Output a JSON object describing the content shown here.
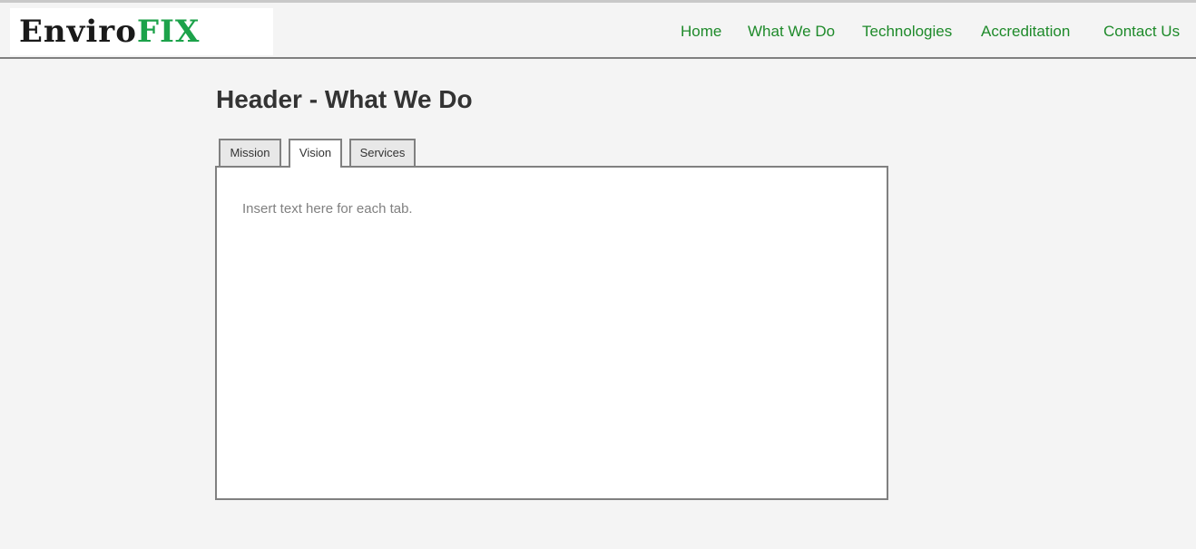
{
  "header": {
    "logo": {
      "part1": "Enviro",
      "part2": "FIX"
    },
    "nav": [
      {
        "label": "Home"
      },
      {
        "label": "What We Do"
      },
      {
        "label": "Technologies"
      },
      {
        "label": "Accreditation"
      },
      {
        "label": "Contact Us"
      }
    ]
  },
  "main": {
    "title": "Header - What We Do",
    "tabs": [
      {
        "label": "Mission",
        "active": false
      },
      {
        "label": "Vision",
        "active": true
      },
      {
        "label": "Services",
        "active": false
      }
    ],
    "panel_text": "Insert text here for each tab."
  },
  "colors": {
    "nav_link": "#1e8a2a",
    "logo_accent": "#1ca24a",
    "background": "#f4f4f4",
    "border": "#808080"
  }
}
